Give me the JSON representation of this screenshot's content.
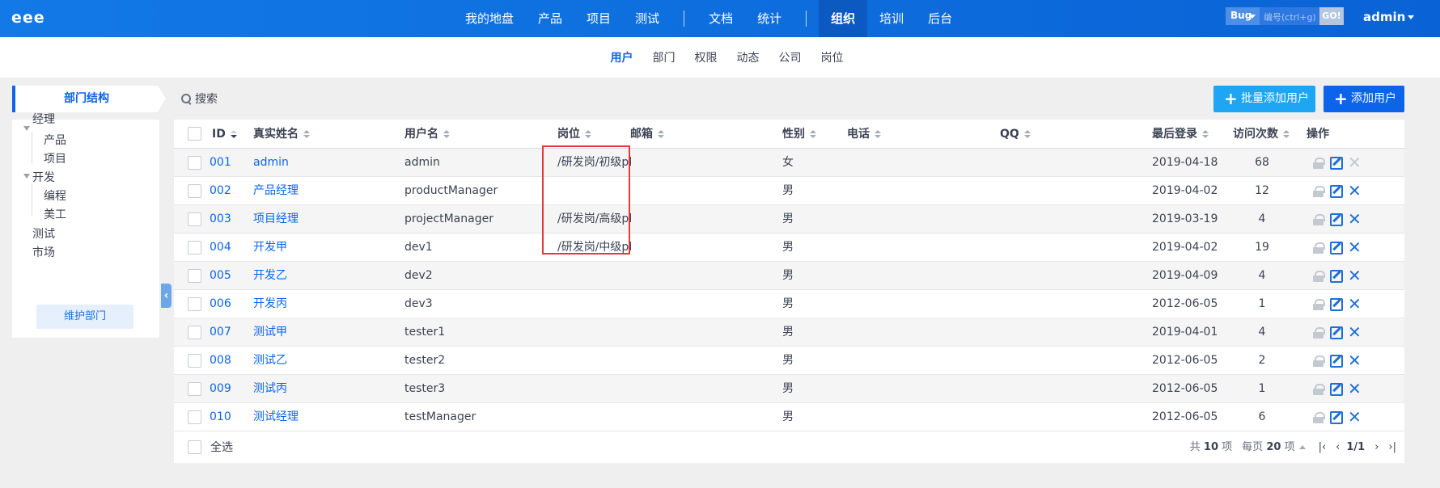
{
  "brand": "eee",
  "nav": {
    "items": [
      "我的地盘",
      "产品",
      "项目",
      "测试"
    ],
    "items2": [
      "文档",
      "统计"
    ],
    "items3": [
      "组织",
      "培训",
      "后台"
    ]
  },
  "search": {
    "type": "Bug",
    "placeholder": "编号(ctrl+g)",
    "go": "GO!"
  },
  "user": "admin",
  "subnav": [
    "用户",
    "部门",
    "权限",
    "动态",
    "公司",
    "岗位"
  ],
  "sidebar": {
    "title": "部门结构",
    "tree": {
      "manager": "经理",
      "product": "产品",
      "project": "项目",
      "dev": "开发",
      "coding": "编程",
      "art": "美工",
      "test": "测试",
      "market": "市场"
    },
    "maintain": "维护部门"
  },
  "toolbar": {
    "search": "搜索",
    "batch_add": "批量添加用户",
    "add_user": "添加用户"
  },
  "table": {
    "headers": {
      "id": "ID",
      "realname": "真实姓名",
      "account": "用户名",
      "role": "岗位",
      "email": "邮箱",
      "gender": "性别",
      "phone": "电话",
      "qq": "QQ",
      "last_login": "最后登录",
      "visits": "访问次数",
      "actions": "操作"
    },
    "rows": [
      {
        "id": "001",
        "realname": "admin",
        "account": "admin",
        "role": "/研发岗/初级pl",
        "gender": "女",
        "last": "2019-04-18",
        "visits": "68"
      },
      {
        "id": "002",
        "realname": "产品经理",
        "account": "productManager",
        "role": "",
        "gender": "男",
        "last": "2019-04-02",
        "visits": "12"
      },
      {
        "id": "003",
        "realname": "项目经理",
        "account": "projectManager",
        "role": "/研发岗/高级pl",
        "gender": "男",
        "last": "2019-03-19",
        "visits": "4"
      },
      {
        "id": "004",
        "realname": "开发甲",
        "account": "dev1",
        "role": "/研发岗/中级pl",
        "gender": "男",
        "last": "2019-04-02",
        "visits": "19"
      },
      {
        "id": "005",
        "realname": "开发乙",
        "account": "dev2",
        "role": "",
        "gender": "男",
        "last": "2019-04-09",
        "visits": "4"
      },
      {
        "id": "006",
        "realname": "开发丙",
        "account": "dev3",
        "role": "",
        "gender": "男",
        "last": "2012-06-05",
        "visits": "1"
      },
      {
        "id": "007",
        "realname": "测试甲",
        "account": "tester1",
        "role": "",
        "gender": "男",
        "last": "2019-04-01",
        "visits": "4"
      },
      {
        "id": "008",
        "realname": "测试乙",
        "account": "tester2",
        "role": "",
        "gender": "男",
        "last": "2012-06-05",
        "visits": "2"
      },
      {
        "id": "009",
        "realname": "测试丙",
        "account": "tester3",
        "role": "",
        "gender": "男",
        "last": "2012-06-05",
        "visits": "1"
      },
      {
        "id": "010",
        "realname": "测试经理",
        "account": "testManager",
        "role": "",
        "gender": "男",
        "last": "2012-06-05",
        "visits": "6"
      }
    ]
  },
  "footer": {
    "select_all": "全选",
    "total_pre": "共",
    "total": "10",
    "total_suf": "项",
    "per_pre": "每页",
    "per": "20",
    "per_suf": "项",
    "page": "1/1"
  },
  "colors": {
    "primary": "#0c64eb",
    "navbar": "#1279e6",
    "info": "#1ea5f3",
    "highlight": "#e4393c"
  }
}
